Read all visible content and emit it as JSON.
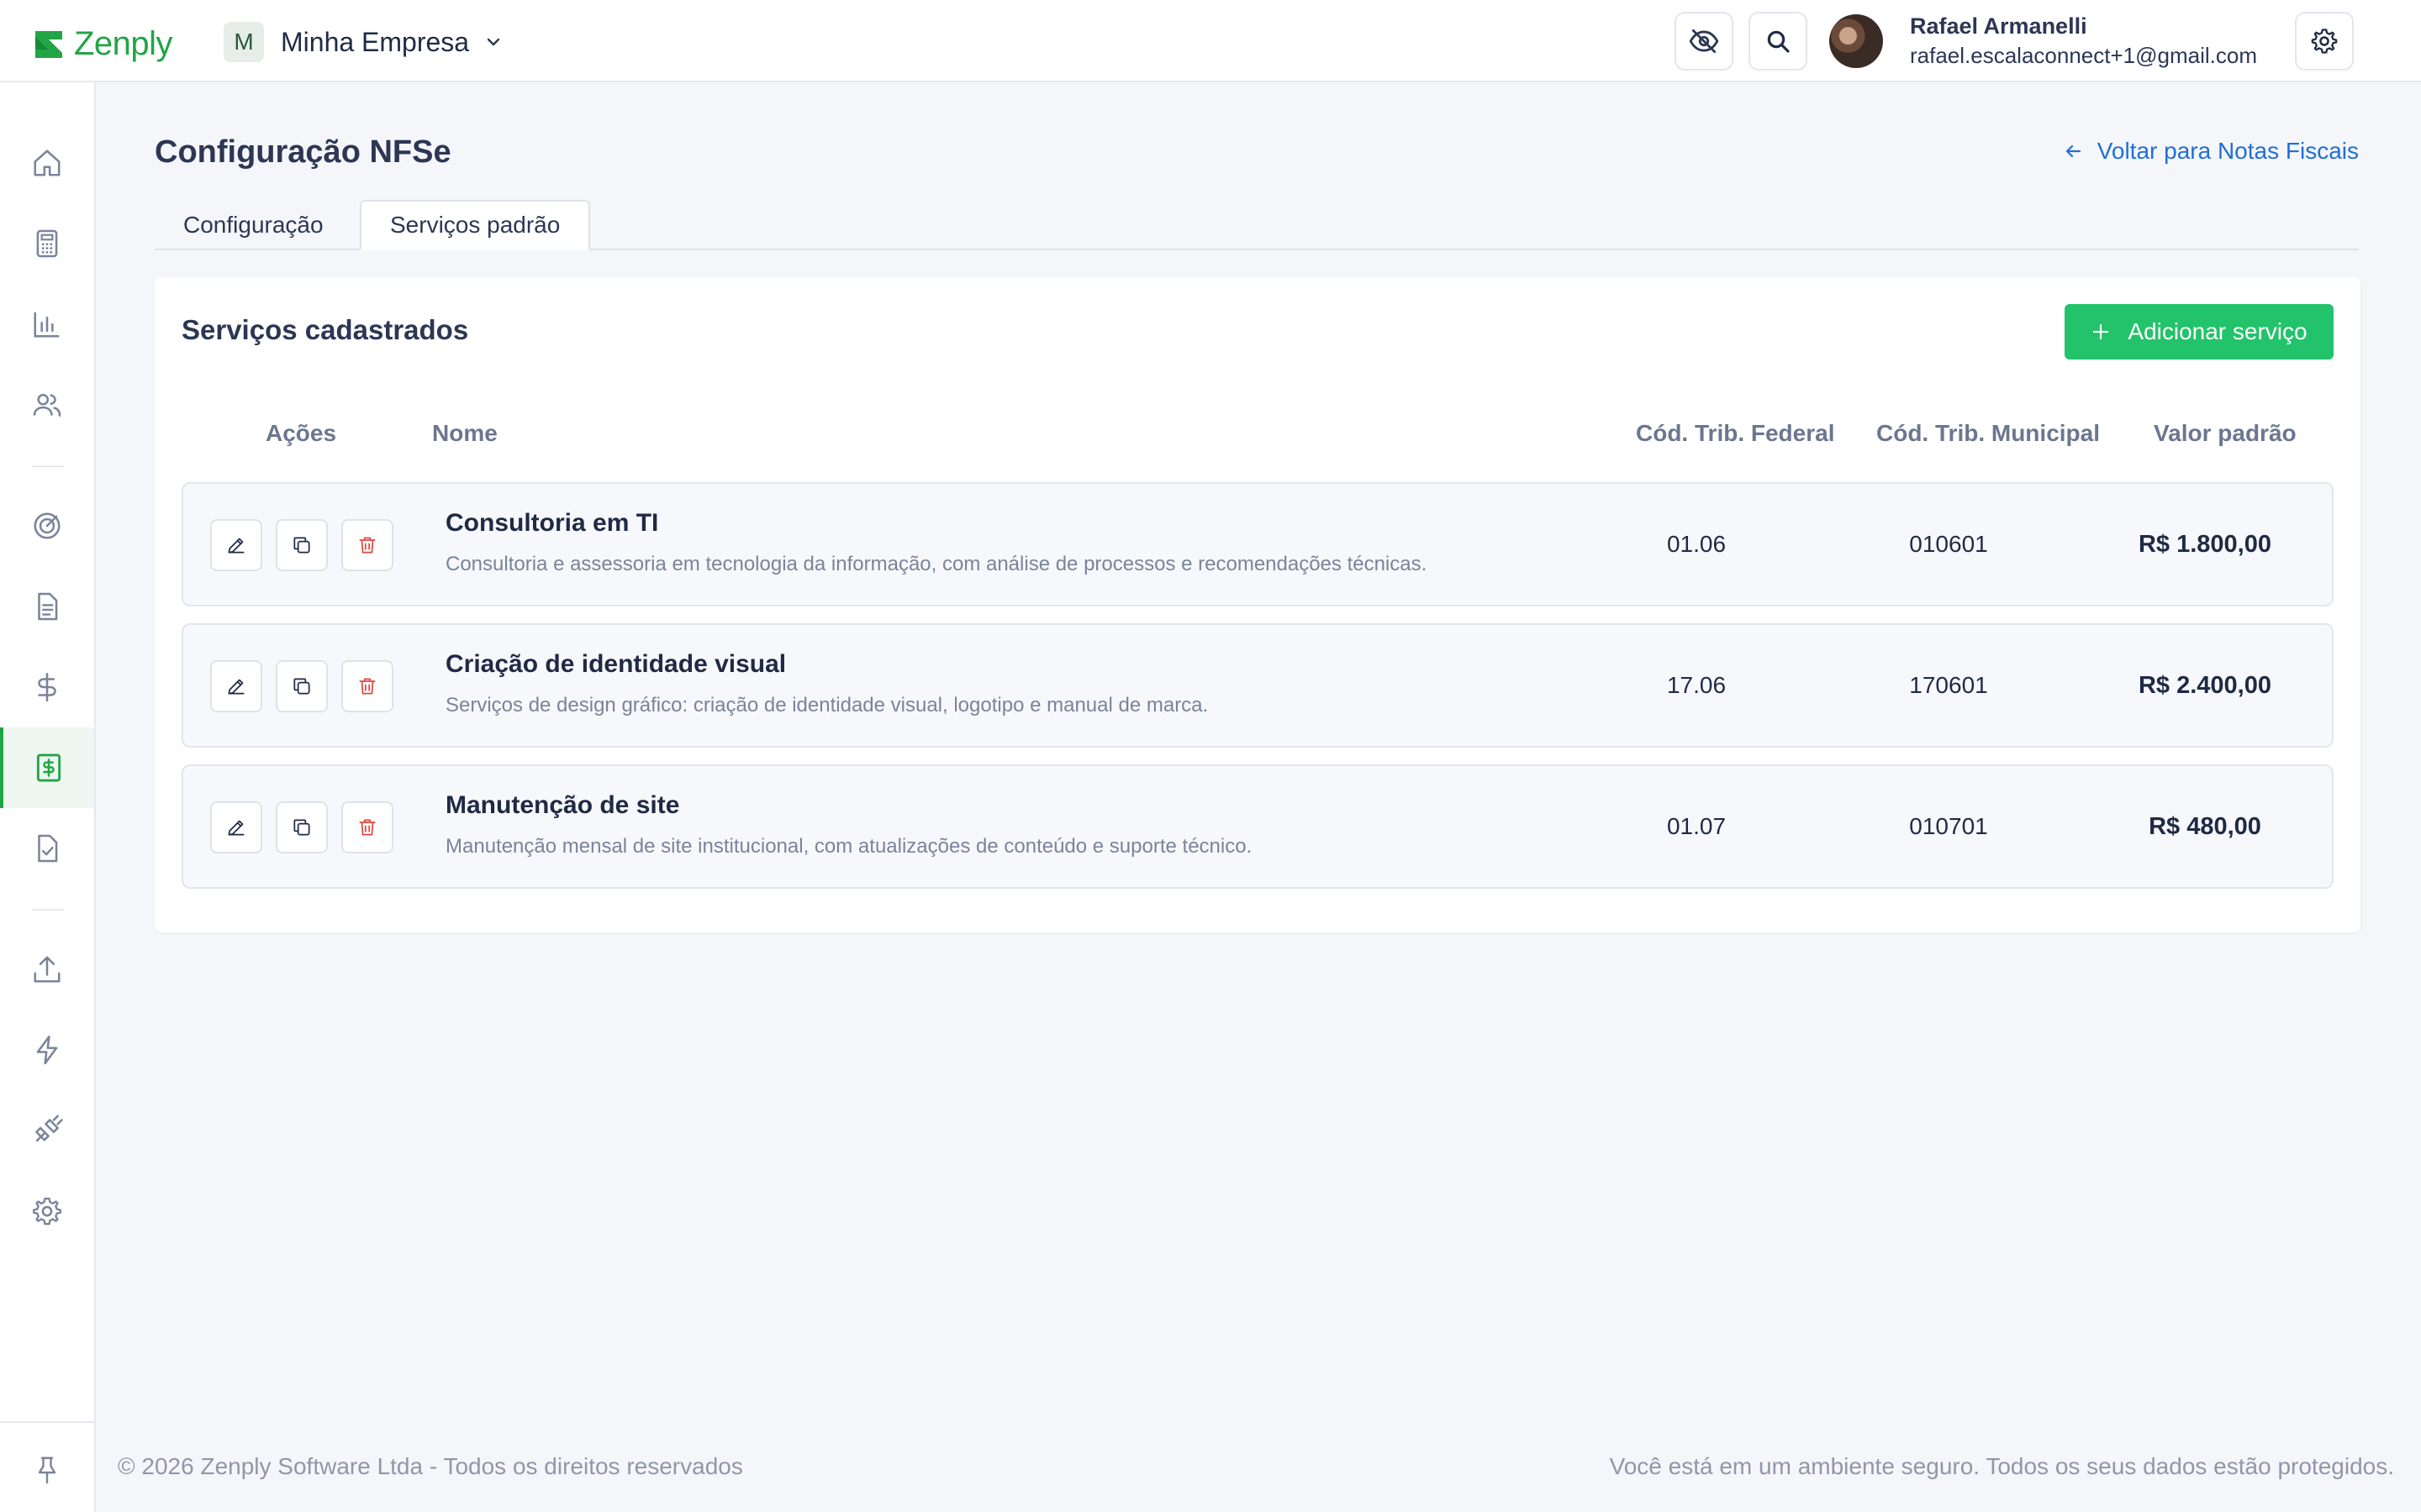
{
  "brand": {
    "name": "Zenply",
    "color": "#22a545"
  },
  "company": {
    "initial": "M",
    "name": "Minha Empresa"
  },
  "user": {
    "name": "Rafael Armanelli",
    "email": "rafael.escalaconnect+1@gmail.com"
  },
  "topbar_icons": [
    "eye-off-icon",
    "search-icon",
    "gear-icon"
  ],
  "sidebar": {
    "items": [
      "home-icon",
      "calculator-icon",
      "bar-chart-icon",
      "users-icon",
      "target-icon",
      "document-icon",
      "dollar-icon",
      "invoice-dollar-icon",
      "document-check-icon",
      "upload-icon",
      "lightning-icon",
      "plug-icon",
      "gear-icon",
      "pin-icon"
    ],
    "active": "invoice-dollar-icon"
  },
  "page": {
    "title": "Configuração NFSe",
    "back_link": "Voltar para Notas Fiscais",
    "tabs": [
      {
        "label": "Configuração",
        "active": false
      },
      {
        "label": "Serviços padrão",
        "active": true
      }
    ]
  },
  "card": {
    "title": "Serviços cadastrados",
    "add_button": "Adicionar serviço",
    "columns": {
      "actions": "Ações",
      "name": "Nome",
      "federal": "Cód. Trib. Federal",
      "municipal": "Cód. Trib. Municipal",
      "value": "Valor padrão"
    },
    "rows": [
      {
        "name": "Consultoria em TI",
        "description": "Consultoria e assessoria em tecnologia da informação, com análise de processos e recomendações técnicas.",
        "federal": "01.06",
        "municipal": "010601",
        "value": "R$ 1.800,00"
      },
      {
        "name": "Criação de identidade visual",
        "description": "Serviços de design gráfico: criação de identidade visual, logotipo e manual de marca.",
        "federal": "17.06",
        "municipal": "170601",
        "value": "R$ 2.400,00"
      },
      {
        "name": "Manutenção de site",
        "description": "Manutenção mensal de site institucional, com atualizações de conteúdo e suporte técnico.",
        "federal": "01.07",
        "municipal": "010701",
        "value": "R$ 480,00"
      }
    ]
  },
  "footer": {
    "left": "© 2026 Zenply Software Ltda - Todos os direitos reservados",
    "right": "Você está em um ambiente seguro. Todos os seus dados estão protegidos."
  },
  "colors": {
    "accent_green": "#22c36a",
    "link_blue": "#1e6fd9",
    "delete_red": "#e0473d"
  }
}
